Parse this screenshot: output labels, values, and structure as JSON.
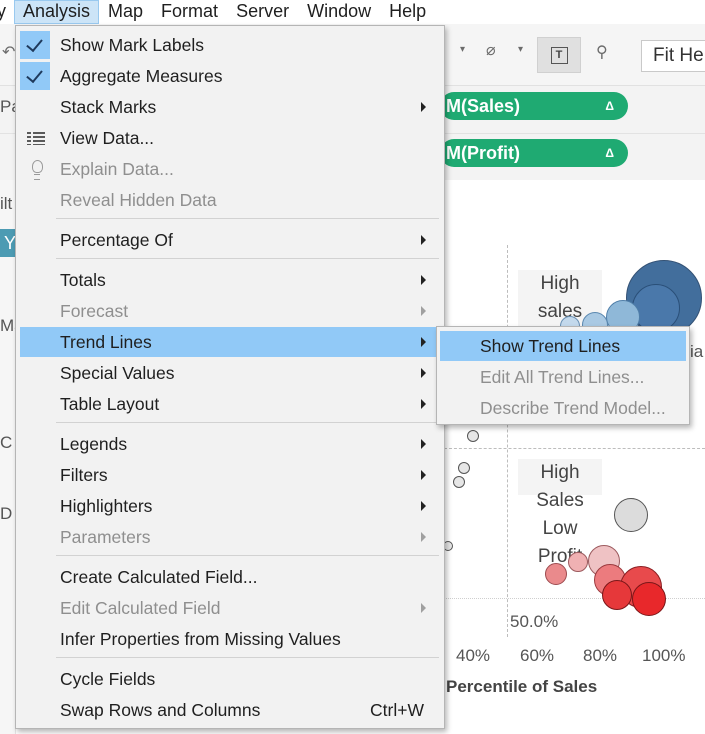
{
  "menubar": {
    "items": [
      "y",
      "Analysis",
      "Map",
      "Format",
      "Server",
      "Window",
      "Help"
    ]
  },
  "toolbar": {
    "fit_label": "Fit He"
  },
  "shelves": {
    "columns_pill": "M(Sales)",
    "rows_pill": "M(Profit)",
    "delta": "Δ"
  },
  "left_panel": {
    "fragments": [
      "Pa",
      "ilt",
      "Y",
      "Ma",
      "C",
      "D"
    ]
  },
  "chart": {
    "quadrant_high_sales": "High\nsales",
    "quadrant_high_sales_low_profit": "High\nSales\nLow\nProfit",
    "ref_label": "50.0%",
    "clipped_label": "ia",
    "x_ticks": [
      "40%",
      "60%",
      "80%",
      "100%"
    ],
    "x_title": "Percentile of Sales"
  },
  "analysis_menu": {
    "show_mark_labels": "Show Mark Labels",
    "aggregate_measures": "Aggregate Measures",
    "stack_marks": "Stack Marks",
    "view_data": "View Data...",
    "explain_data": "Explain Data...",
    "reveal_hidden_data": "Reveal Hidden Data",
    "percentage_of": "Percentage Of",
    "totals": "Totals",
    "forecast": "Forecast",
    "trend_lines": "Trend Lines",
    "special_values": "Special Values",
    "table_layout": "Table Layout",
    "legends": "Legends",
    "filters": "Filters",
    "highlighters": "Highlighters",
    "parameters": "Parameters",
    "create_calculated_field": "Create Calculated Field...",
    "edit_calculated_field": "Edit Calculated Field",
    "infer_properties": "Infer Properties from Missing Values",
    "cycle_fields": "Cycle Fields",
    "swap_rows_columns": "Swap Rows and Columns",
    "swap_shortcut": "Ctrl+W"
  },
  "trend_submenu": {
    "show_trend_lines": "Show Trend Lines",
    "edit_all_trend_lines": "Edit All Trend Lines...",
    "describe_trend_model": "Describe Trend Model..."
  },
  "colors": {
    "menu_highlight": "#91c9f7",
    "pill_green": "#1faa72",
    "bubble_blue": "#2e5f92",
    "bubble_red": "#e8282b"
  }
}
